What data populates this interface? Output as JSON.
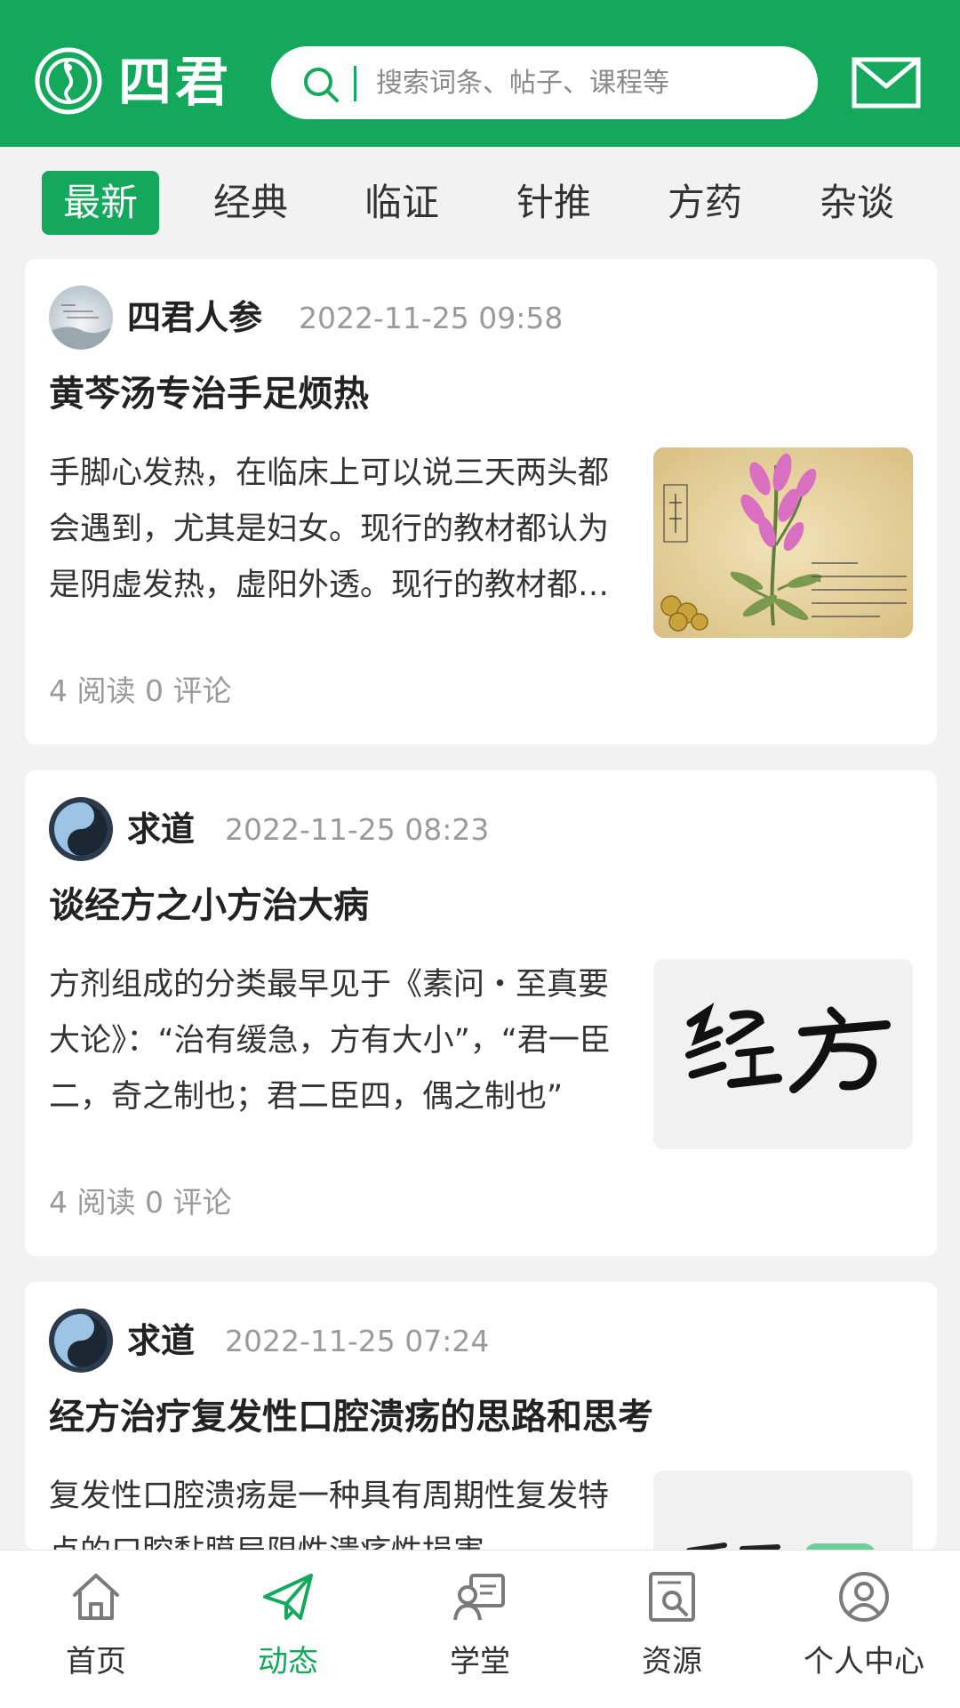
{
  "header": {
    "logo_text": "四君",
    "search_placeholder": "搜索词条、帖子、课程等",
    "mail_icon": "mail-icon"
  },
  "tabs": [
    {
      "label": "最新",
      "active": true
    },
    {
      "label": "经典",
      "active": false
    },
    {
      "label": "临证",
      "active": false
    },
    {
      "label": "针推",
      "active": false
    },
    {
      "label": "方药",
      "active": false
    },
    {
      "label": "杂谈",
      "active": false
    }
  ],
  "posts": [
    {
      "author": "四君人参",
      "time": "2022-11-25 09:58",
      "title": "黄芩汤专治手足烦热",
      "summary": "手脚心发热，在临床上可以说三天两头都会遇到，尤其是妇女。现行的教材都认为是阴虚发热，虚阳外透。现行的教材都认为是阴虚发热",
      "stats": "4 阅读  0 评论",
      "thumb_label": "【黄芩】",
      "thumb_caption": [
        "性味：苦，寒。",
        "归经：归肺、胆、胃、大肠经。",
        "功效：清热燥湿，泻火解毒，",
        "降压，保肝利胆，抑制肠管蠕",
        "止血，安胎等功效。"
      ]
    },
    {
      "author": "求道",
      "time": "2022-11-25 08:23",
      "title": "谈经方之小方治大病",
      "summary": "方剂组成的分类最早见于《素问・至真要大论》：“治有缓急，方有大小”，“君一臣二，奇之制也；君二臣四，偶之制也”",
      "stats": "4 阅读  0 评论",
      "thumb_label": "经 方"
    },
    {
      "author": "求道",
      "time": "2022-11-25 07:24",
      "title": "经方治疗复发性口腔溃疡的思路和思考",
      "summary": "复发性口腔溃疡是一种具有周期性复发特点的口腔黏膜局限性溃疡性损害"
    }
  ],
  "bottom_nav": [
    {
      "label": "首页",
      "icon": "home-icon",
      "active": false
    },
    {
      "label": "动态",
      "icon": "paper-plane-icon",
      "active": true
    },
    {
      "label": "学堂",
      "icon": "classroom-icon",
      "active": false
    },
    {
      "label": "资源",
      "icon": "resource-search-icon",
      "active": false
    },
    {
      "label": "个人中心",
      "icon": "user-icon",
      "active": false
    }
  ],
  "colors": {
    "brand_green": "#14a85d",
    "muted_text": "#9a9a9a"
  }
}
